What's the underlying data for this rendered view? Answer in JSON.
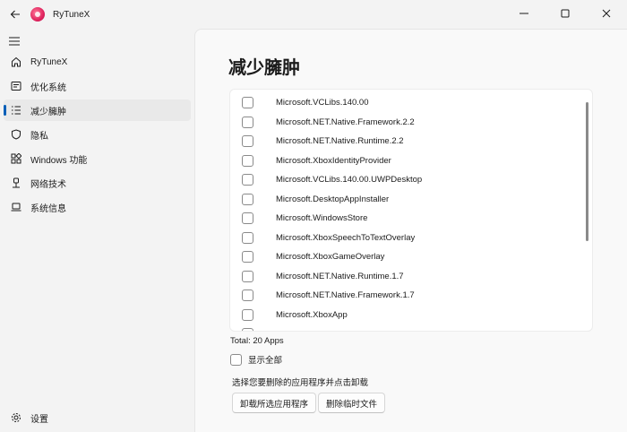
{
  "window": {
    "title": "RyTuneX",
    "back_icon": "arrow-left-icon",
    "controls": [
      "minimize-icon",
      "maximize-icon",
      "close-icon"
    ]
  },
  "sidebar": {
    "items": [
      {
        "label": "RyTuneX",
        "icon": "home-icon"
      },
      {
        "label": "优化系统",
        "icon": "optimize-icon"
      },
      {
        "label": "减少臃肿",
        "icon": "list-icon",
        "active": true
      },
      {
        "label": "隐私",
        "icon": "shield-icon"
      },
      {
        "label": "Windows 功能",
        "icon": "apps-icon"
      },
      {
        "label": "网络技术",
        "icon": "network-icon"
      },
      {
        "label": "系统信息",
        "icon": "laptop-icon"
      }
    ],
    "settings_label": "设置"
  },
  "page": {
    "title": "减少臃肿",
    "apps": [
      "Microsoft.VCLibs.140.00",
      "Microsoft.NET.Native.Framework.2.2",
      "Microsoft.NET.Native.Runtime.2.2",
      "Microsoft.XboxIdentityProvider",
      "Microsoft.VCLibs.140.00.UWPDesktop",
      "Microsoft.DesktopAppInstaller",
      "Microsoft.WindowsStore",
      "Microsoft.XboxSpeechToTextOverlay",
      "Microsoft.XboxGameOverlay",
      "Microsoft.NET.Native.Runtime.1.7",
      "Microsoft.NET.Native.Framework.1.7",
      "Microsoft.XboxApp"
    ],
    "total": "Total: 20 Apps",
    "show_all_label": "显示全部",
    "hint": "选择您要删除的应用程序并点击卸载",
    "uninstall_button": "卸载所选应用程序",
    "delete_temp_button": "删除临时文件"
  },
  "colors": {
    "accent": "#005fb8",
    "logo": "#e0245e"
  }
}
